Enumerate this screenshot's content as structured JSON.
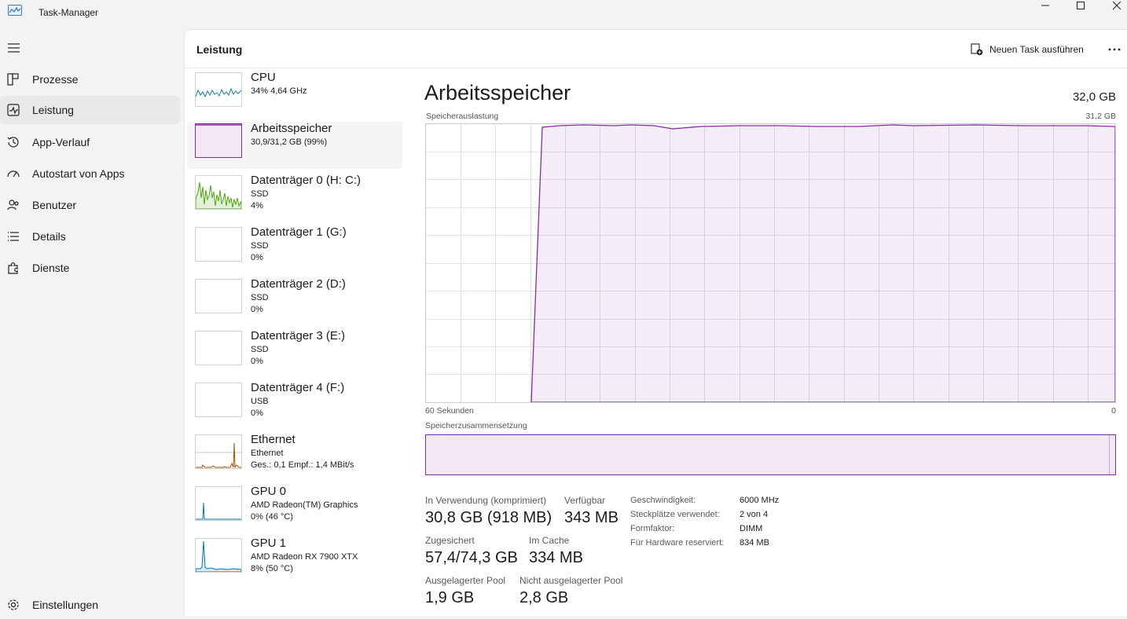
{
  "window": {
    "title": "Task-Manager"
  },
  "nav": {
    "items": [
      {
        "label": "Prozesse"
      },
      {
        "label": "Leistung"
      },
      {
        "label": "App-Verlauf"
      },
      {
        "label": "Autostart von Apps"
      },
      {
        "label": "Benutzer"
      },
      {
        "label": "Details"
      },
      {
        "label": "Dienste"
      }
    ],
    "settings": "Einstellungen"
  },
  "header": {
    "title": "Leistung",
    "new_task": "Neuen Task ausführen"
  },
  "perf_list": [
    {
      "title": "CPU",
      "l1": "34% 4,64 GHz",
      "l2": ""
    },
    {
      "title": "Arbeitsspeicher",
      "l1": "30,9/31,2 GB (99%)",
      "l2": ""
    },
    {
      "title": "Datenträger 0 (H: C:)",
      "l1": "SSD",
      "l2": "4%"
    },
    {
      "title": "Datenträger 1 (G:)",
      "l1": "SSD",
      "l2": "0%"
    },
    {
      "title": "Datenträger 2 (D:)",
      "l1": "SSD",
      "l2": "0%"
    },
    {
      "title": "Datenträger 3 (E:)",
      "l1": "SSD",
      "l2": "0%"
    },
    {
      "title": "Datenträger 4 (F:)",
      "l1": "USB",
      "l2": "0%"
    },
    {
      "title": "Ethernet",
      "l1": "Ethernet",
      "l2": "Ges.: 0,1 Empf.: 1,4 MBit/s"
    },
    {
      "title": "GPU 0",
      "l1": "AMD Radeon(TM) Graphics",
      "l2": "0% (46 °C)"
    },
    {
      "title": "GPU 1",
      "l1": "AMD Radeon RX 7900 XTX",
      "l2": "8% (50 °C)"
    }
  ],
  "detail": {
    "title": "Arbeitsspeicher",
    "total": "32,0 GB",
    "usage_label": "Speicherauslastung",
    "usage_max": "31,2 GB",
    "time_left": "60 Sekunden",
    "time_right": "0",
    "composition_label": "Speicherzusammensetzung",
    "stats": {
      "in_use_label": "In Verwendung (komprimiert)",
      "in_use_value": "30,8 GB (918 MB)",
      "available_label": "Verfügbar",
      "available_value": "343 MB",
      "committed_label": "Zugesichert",
      "committed_value": "57,4/74,3 GB",
      "cached_label": "Im Cache",
      "cached_value": "334 MB",
      "paged_label": "Ausgelagerter Pool",
      "paged_value": "1,9 GB",
      "nonpaged_label": "Nicht ausgelagerter Pool",
      "nonpaged_value": "2,8 GB"
    },
    "props": [
      {
        "label": "Geschwindigkeit:",
        "value": "6000 MHz"
      },
      {
        "label": "Steckplätze verwendet:",
        "value": "2 von 4"
      },
      {
        "label": "Formfaktor:",
        "value": "DIMM"
      },
      {
        "label": "Für Hardware reserviert:",
        "value": "834 MB"
      }
    ]
  },
  "colors": {
    "memory": "#8a2aa8",
    "cpu": "#117dbb",
    "disk": "#4da60c",
    "ethernet": "#a74f01",
    "gpu": "#0078b4"
  }
}
